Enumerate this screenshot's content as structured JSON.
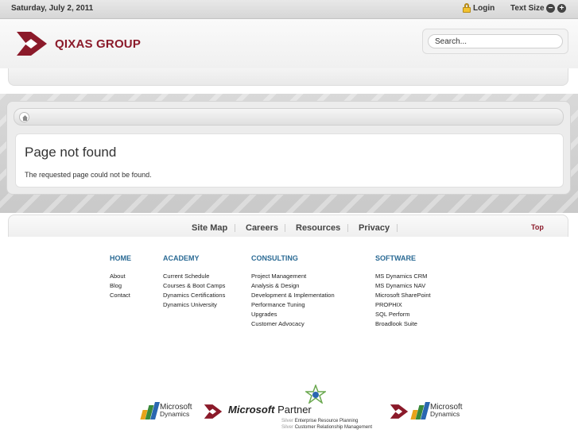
{
  "topbar": {
    "date": "Saturday, July 2, 2011",
    "login": "Login",
    "text_size": "Text Size",
    "decrease": "−",
    "increase": "+"
  },
  "header": {
    "logo_text": "QIXAS GROUP",
    "search_placeholder": "Search...",
    "brand_color": "#8b1a2a"
  },
  "content": {
    "title": "Page not found",
    "message": "The requested page could not be found."
  },
  "footer_nav": {
    "links": [
      "Site Map",
      "Careers",
      "Resources",
      "Privacy"
    ],
    "top": "Top"
  },
  "sitemap": {
    "columns": [
      {
        "heading": "HOME",
        "items": [
          "About",
          "Blog",
          "Contact"
        ]
      },
      {
        "heading": "ACADEMY",
        "items": [
          "Current Schedule",
          "Courses & Boot Camps",
          "Dynamics Certifications",
          "Dynamics University"
        ]
      },
      {
        "heading": "CONSULTING",
        "items": [
          "Project Management",
          "Analysis & Design",
          "Development & Implementation",
          "Performance Tuning",
          "Upgrades",
          "Customer Advocacy"
        ]
      },
      {
        "heading": "SOFTWARE",
        "items": [
          "MS Dynamics CRM",
          "MS Dynamics NAV",
          "Microsoft SharePoint",
          "PROPHIX",
          "SQL Perform",
          "Broadlook Suite"
        ]
      }
    ],
    "heading_color": "#2a6a94"
  },
  "partners": {
    "ms_line1": "Microsoft",
    "ms_line2": "Dynamics",
    "partner_ms": "Microsoft",
    "partner_word": "Partner",
    "silver": "Silver",
    "erp": "Enterprise Resource Planning",
    "crm": "Customer Relationship Management"
  }
}
